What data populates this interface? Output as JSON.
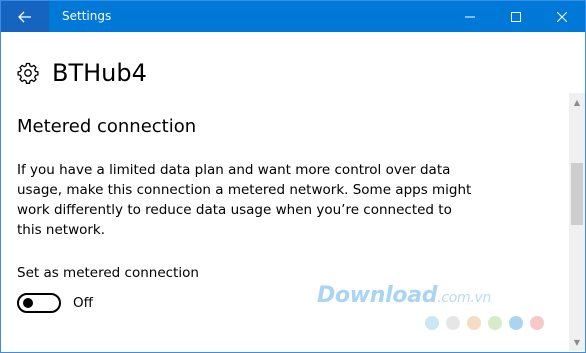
{
  "window": {
    "title": "Settings"
  },
  "header": {
    "title": "BTHub4",
    "icon": "gear-icon"
  },
  "metered": {
    "section_title": "Metered connection",
    "description_lines": [
      "If you have a limited data plan and want more control over data",
      "usage, make this connection a metered network. Some apps might",
      "work differently to reduce data usage when you’re connected to",
      "this network."
    ],
    "toggle_label": "Set as metered connection",
    "toggle_state": "Off",
    "toggle_on": false
  },
  "watermark": {
    "brand": "Download",
    "suffix": ".com.vn",
    "dot_colors": [
      "#c9e7f7",
      "#e6e6e6",
      "#f5dcc4",
      "#d6ecc8",
      "#a9d4f2",
      "#f6c9c9"
    ]
  },
  "colors": {
    "titlebar": "#0078d7",
    "accent": "#0078d7"
  }
}
